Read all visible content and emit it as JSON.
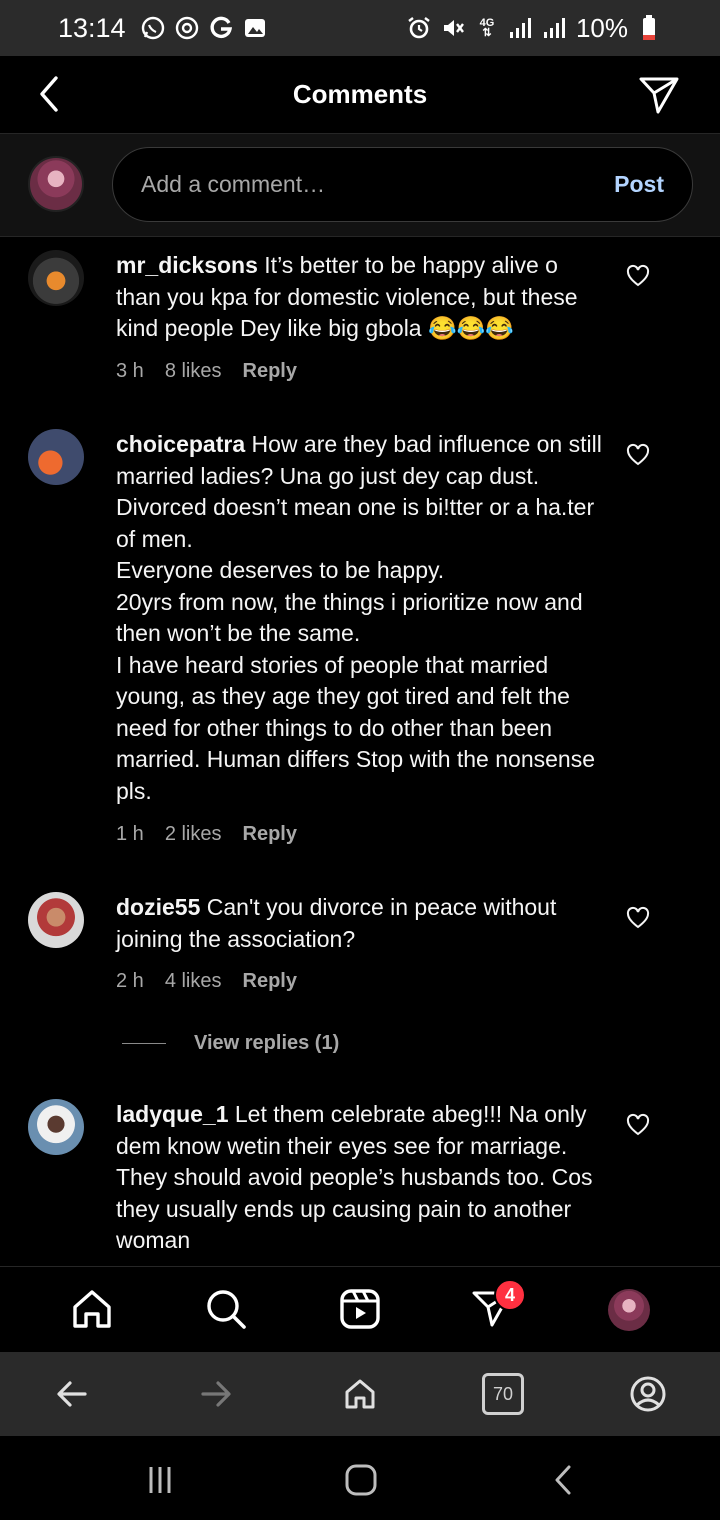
{
  "status_bar": {
    "time": "13:14",
    "network": "4G",
    "battery": "10%"
  },
  "header": {
    "title": "Comments"
  },
  "composer": {
    "placeholder": "Add a comment…",
    "post_label": "Post"
  },
  "comments": [
    {
      "username": "mr_dicksons",
      "text": "It’s better to be happy alive o than you kpa for domestic violence, but these kind people Dey like big gbola 😂😂😂",
      "time": "3 h",
      "likes": "8 likes",
      "reply": "Reply"
    },
    {
      "username": "choicepatra",
      "text": "How are they bad influence on still married ladies? Una go just dey cap dust. Divorced doesn’t mean one is bi!tter or a ha.ter of men.\nEveryone deserves to be happy.\n20yrs from now, the things i prioritize now and then won’t be the same.\nI have heard stories of people that married young, as they age they got tired and felt the need for other things to do other than been married. Human differs Stop with the nonsense pls.",
      "time": "1 h",
      "likes": "2 likes",
      "reply": "Reply"
    },
    {
      "username": "dozie55",
      "text": "Can't you divorce in peace without joining the association?",
      "time": "2 h",
      "likes": "4 likes",
      "reply": "Reply",
      "view_replies": "View replies (1)"
    },
    {
      "username": "ladyque_1",
      "text": "Let them celebrate abeg!!! Na only dem know wetin their eyes see for marriage. They should avoid people’s husbands too. Cos they usually ends up causing pain to another woman"
    }
  ],
  "bottom_nav": {
    "items": [
      "home-icon",
      "search-icon",
      "reels-icon",
      "direct-icon",
      "profile-avatar"
    ],
    "badge": "4"
  },
  "browser_bar": {
    "tab_count": "70"
  },
  "colors": {
    "background": "#000000",
    "text": "#f5f5f5",
    "muted": "#a8a8a8",
    "post": "#b3d4ff",
    "badge": "#ff3040"
  }
}
